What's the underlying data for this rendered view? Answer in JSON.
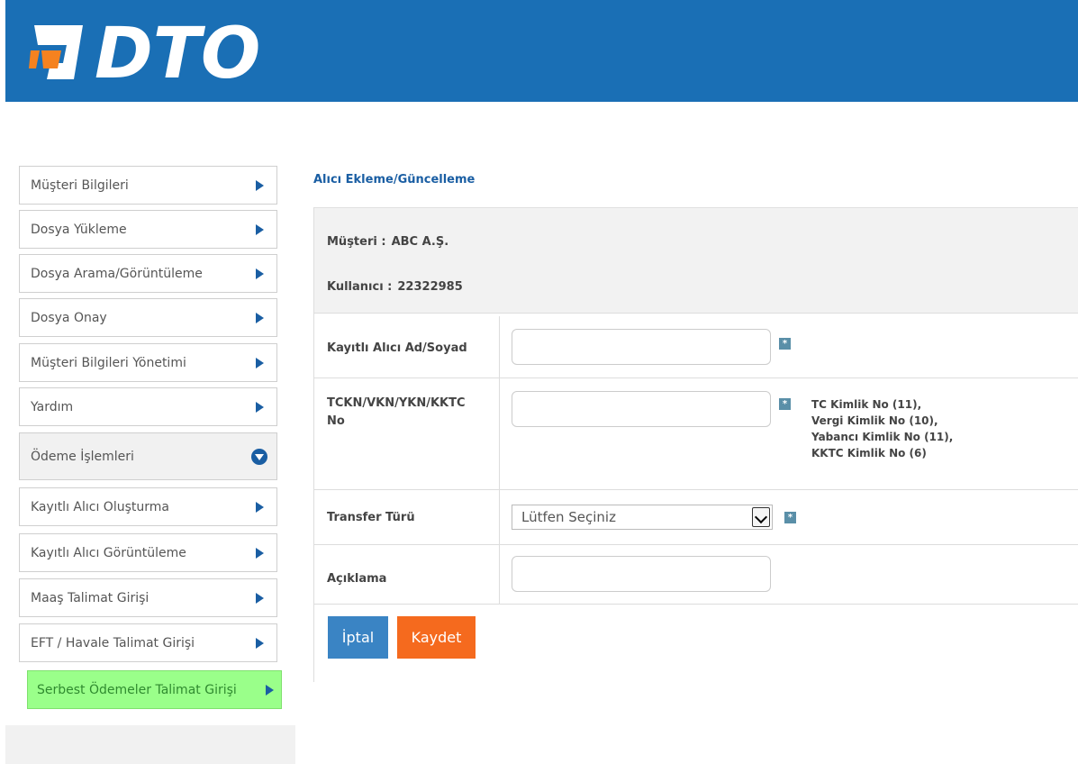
{
  "header": {
    "logo_text": "DTO",
    "colors": {
      "background": "#1a6fb5",
      "logo_accent": "#f5821f",
      "logo_text": "#ffffff"
    }
  },
  "sidebar": {
    "items": [
      {
        "label": "Müşteri Bilgileri",
        "icon": "triangle-right-icon"
      },
      {
        "label": "Dosya Yükleme",
        "icon": "triangle-right-icon"
      },
      {
        "label": "Dosya Arama/Görüntüleme",
        "icon": "triangle-right-icon"
      },
      {
        "label": "Dosya Onay",
        "icon": "triangle-right-icon"
      },
      {
        "label": "Müşteri Bilgileri Yönetimi",
        "icon": "triangle-right-icon"
      },
      {
        "label": "Yardım",
        "icon": "triangle-right-icon"
      },
      {
        "label": "Ödeme İşlemleri",
        "icon": "circle-chevron-down-icon",
        "expanded": true
      },
      {
        "label": "Kayıtlı Alıcı Oluşturma",
        "icon": "triangle-right-icon"
      },
      {
        "label": "Kayıtlı Alıcı Görüntüleme",
        "icon": "triangle-right-icon"
      },
      {
        "label": "Maaş Talimat Girişi",
        "icon": "triangle-right-icon"
      },
      {
        "label": "EFT / Havale Talimat Girişi",
        "icon": "triangle-right-icon"
      },
      {
        "label": "Serbest Ödemeler Talimat Girişi",
        "icon": "triangle-right-icon",
        "highlighted": true
      }
    ]
  },
  "main": {
    "title": "Alıcı Ekleme/Güncelleme",
    "info": {
      "customer_label": "Müşteri :",
      "customer_value": "ABC A.Ş.",
      "user_label": "Kullanıcı :",
      "user_value": "22322985"
    },
    "form": {
      "name_label": "Kayıtlı Alıcı Ad/Soyad",
      "name_value": "",
      "id_label_line1": "TCKN/VKN/YKN/KKTC",
      "id_label_line2": "No",
      "id_value": "",
      "id_hints": [
        "TC Kimlik No (11),",
        "Vergi Kimlik No (10),",
        "Yabancı Kimlik No (11),",
        "KKTC Kimlik No (6)"
      ],
      "transfer_label": "Transfer Türü",
      "transfer_selected": "Lütfen Seçiniz",
      "description_label": "Açıklama",
      "description_value": "",
      "required_mark": "*"
    },
    "buttons": {
      "cancel": "İptal",
      "save": "Kaydet"
    }
  }
}
